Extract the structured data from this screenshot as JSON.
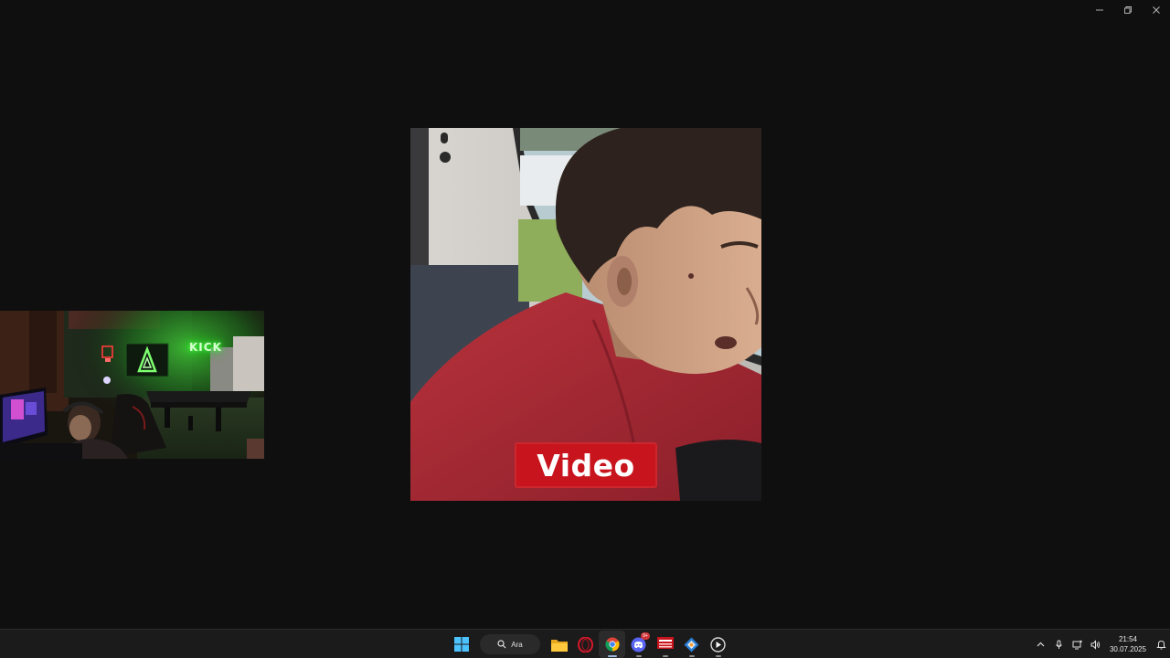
{
  "window_controls": {
    "minimize_icon": "minimize-icon",
    "restore_icon": "restore-icon",
    "close_icon": "close-icon"
  },
  "video": {
    "caption": "Video",
    "caption_color": "#c8141d"
  },
  "webcam": {
    "neon_sign": "KICK"
  },
  "taskbar": {
    "search_label": "Ara",
    "apps": [
      "start-icon",
      "search",
      "file-explorer-icon",
      "opera-icon",
      "chrome-icon",
      "discord-icon",
      "news-app-icon",
      "app-icon",
      "media-player-icon"
    ],
    "discord_badge": "9+",
    "news_app_text": "BUGÜN\nHABER"
  },
  "tray": {
    "chevron": "chevron-up-icon",
    "time": "21:54",
    "date": "30.07.2025"
  }
}
